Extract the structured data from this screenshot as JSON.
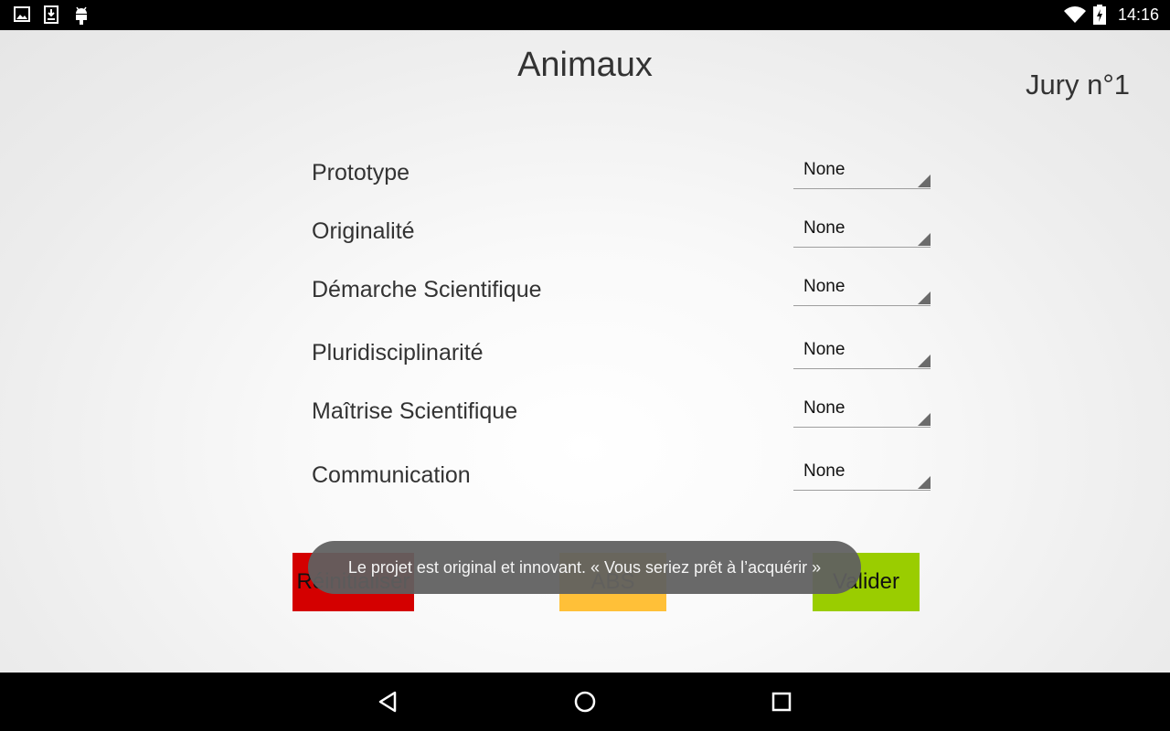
{
  "status_bar": {
    "time": "14:16",
    "left_icons": [
      "image-icon",
      "download-icon",
      "android-icon"
    ],
    "right_icons": [
      "wifi-icon",
      "battery-charging-icon"
    ]
  },
  "screen": {
    "title": "Animaux",
    "jury": "Jury n°1"
  },
  "criteria": [
    {
      "label": "Prototype",
      "value": "None"
    },
    {
      "label": "Originalité",
      "value": "None"
    },
    {
      "label": "Démarche Scientifique",
      "value": "None"
    },
    {
      "label": "Pluridisciplinarité",
      "value": "None"
    },
    {
      "label": "Maîtrise Scientifique",
      "value": "None"
    },
    {
      "label": "Communication",
      "value": "None"
    }
  ],
  "buttons": {
    "reset": "Réinitialiser",
    "abs": "ABS",
    "validate": "Valider"
  },
  "toast": {
    "message": "Le projet est original et innovant. « Vous seriez prêt à l’acquérir »"
  },
  "colors": {
    "reset": "#d40000",
    "abs": "#ffc038",
    "validate": "#9acd00"
  },
  "nav_bar": {
    "icons": [
      "back-icon",
      "home-icon",
      "recents-icon"
    ]
  }
}
